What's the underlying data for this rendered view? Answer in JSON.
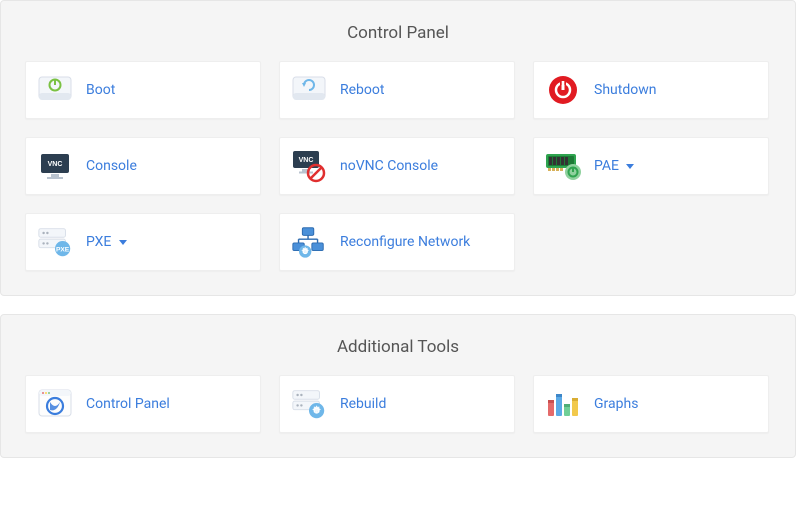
{
  "sections": [
    {
      "title": "Control Panel",
      "items": [
        {
          "label": "Boot"
        },
        {
          "label": "Reboot"
        },
        {
          "label": "Shutdown"
        },
        {
          "label": "Console"
        },
        {
          "label": "noVNC Console"
        },
        {
          "label": "PAE",
          "dropdown": true
        },
        {
          "label": "PXE",
          "dropdown": true
        },
        {
          "label": "Reconfigure Network"
        }
      ]
    },
    {
      "title": "Additional Tools",
      "items": [
        {
          "label": "Control Panel"
        },
        {
          "label": "Rebuild"
        },
        {
          "label": "Graphs"
        }
      ]
    }
  ]
}
